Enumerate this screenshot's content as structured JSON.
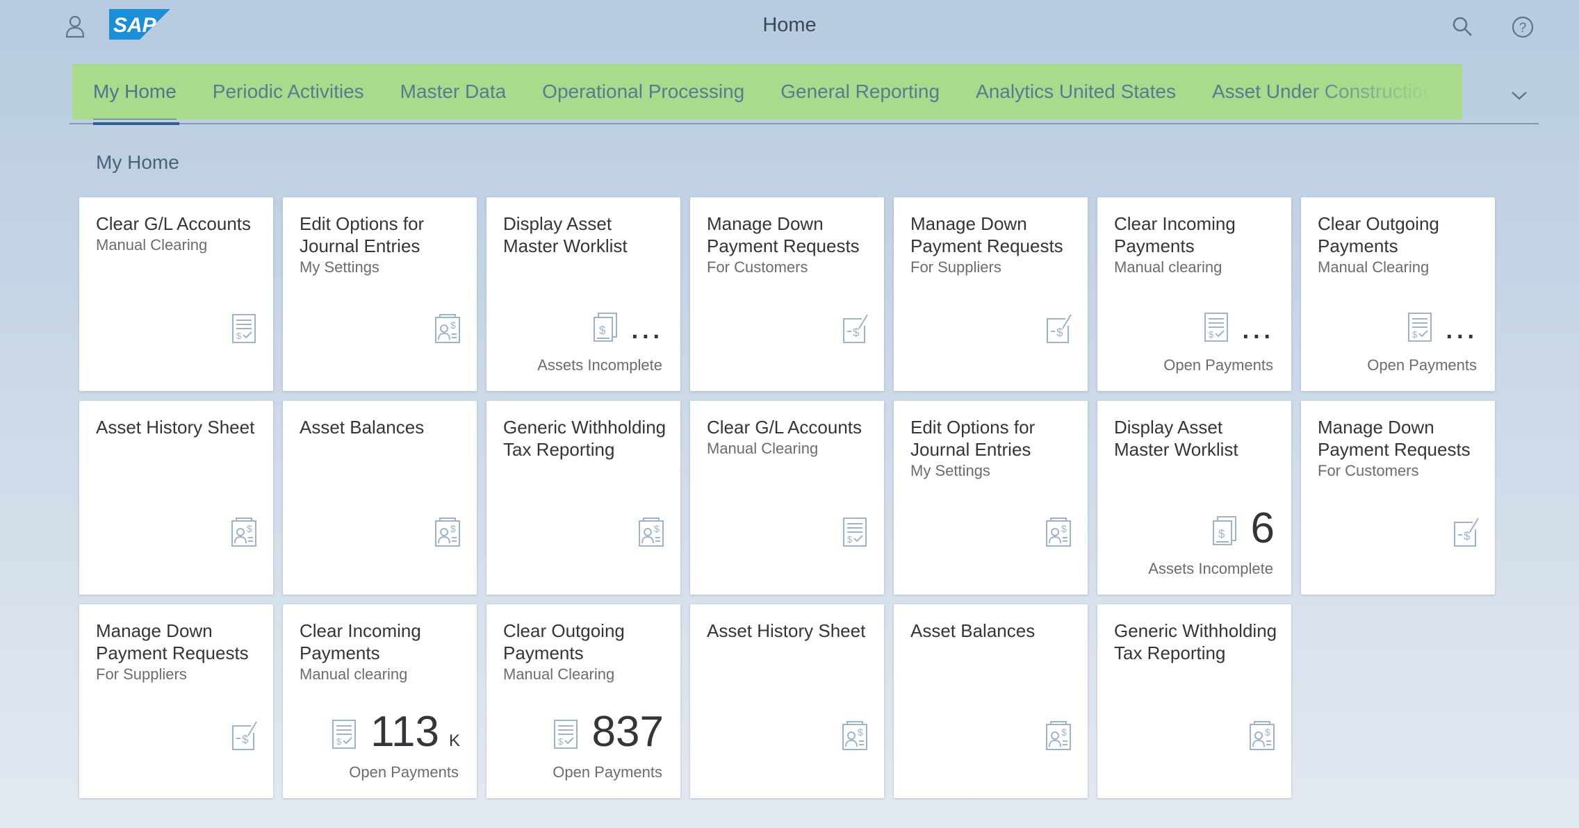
{
  "shell": {
    "title": "Home",
    "logo_text": "SAP"
  },
  "tabs": [
    "My Home",
    "Periodic Activities",
    "Master Data",
    "Operational Processing",
    "General Reporting",
    "Analytics United States",
    "Asset Under Construction"
  ],
  "section_title": "My Home",
  "colors": {
    "tabbar_bg": "#a8dc8c",
    "logo_blue": "#1a8fd8",
    "icon_blue": "#9cb3c9"
  },
  "tiles": [
    {
      "title": "Clear G/L Accounts",
      "subtitle": "Manual Clearing",
      "icon": "invoice-check-icon"
    },
    {
      "title": "Edit Options for Journal Entries",
      "subtitle": "My Settings",
      "icon": "person-dollar-icon"
    },
    {
      "title": "Display Asset Master Worklist",
      "subtitle": "",
      "icon": "dollar-document-icon",
      "kpi": "...",
      "footer": "Assets Incomplete"
    },
    {
      "title": "Manage Down Payment Requests",
      "subtitle": "For Customers",
      "icon": "dollar-edit-icon"
    },
    {
      "title": "Manage Down Payment Requests",
      "subtitle": "For Suppliers",
      "icon": "dollar-edit-icon"
    },
    {
      "title": "Clear Incoming Payments",
      "subtitle": "Manual clearing",
      "icon": "invoice-check-icon",
      "kpi": "...",
      "footer": "Open Payments"
    },
    {
      "title": "Clear Outgoing Payments",
      "subtitle": "Manual Clearing",
      "icon": "invoice-check-icon",
      "kpi": "...",
      "footer": "Open Payments"
    },
    {
      "title": "Asset History Sheet",
      "subtitle": "",
      "icon": "person-dollar-icon"
    },
    {
      "title": "Asset Balances",
      "subtitle": "",
      "icon": "person-dollar-icon"
    },
    {
      "title": "Generic Withholding Tax Reporting",
      "subtitle": "",
      "icon": "person-dollar-icon"
    },
    {
      "title": "Clear G/L Accounts",
      "subtitle": "Manual Clearing",
      "icon": "invoice-check-icon"
    },
    {
      "title": "Edit Options for Journal Entries",
      "subtitle": "My Settings",
      "icon": "person-dollar-icon"
    },
    {
      "title": "Display Asset Master Worklist",
      "subtitle": "",
      "icon": "dollar-document-icon",
      "kpi": "6",
      "footer": "Assets Incomplete"
    },
    {
      "title": "Manage Down Payment Requests",
      "subtitle": "For Customers",
      "icon": "dollar-edit-icon"
    },
    {
      "title": "Manage Down Payment Requests",
      "subtitle": "For Suppliers",
      "icon": "dollar-edit-icon"
    },
    {
      "title": "Clear Incoming Payments",
      "subtitle": "Manual clearing",
      "icon": "invoice-check-icon",
      "kpi": "113",
      "unit": "K",
      "footer": "Open Payments"
    },
    {
      "title": "Clear Outgoing Payments",
      "subtitle": "Manual Clearing",
      "icon": "invoice-check-icon",
      "kpi": "837",
      "footer": "Open Payments"
    },
    {
      "title": "Asset History Sheet",
      "subtitle": "",
      "icon": "person-dollar-icon"
    },
    {
      "title": "Asset Balances",
      "subtitle": "",
      "icon": "person-dollar-icon"
    },
    {
      "title": "Generic Withholding Tax Reporting",
      "subtitle": "",
      "icon": "person-dollar-icon"
    }
  ]
}
